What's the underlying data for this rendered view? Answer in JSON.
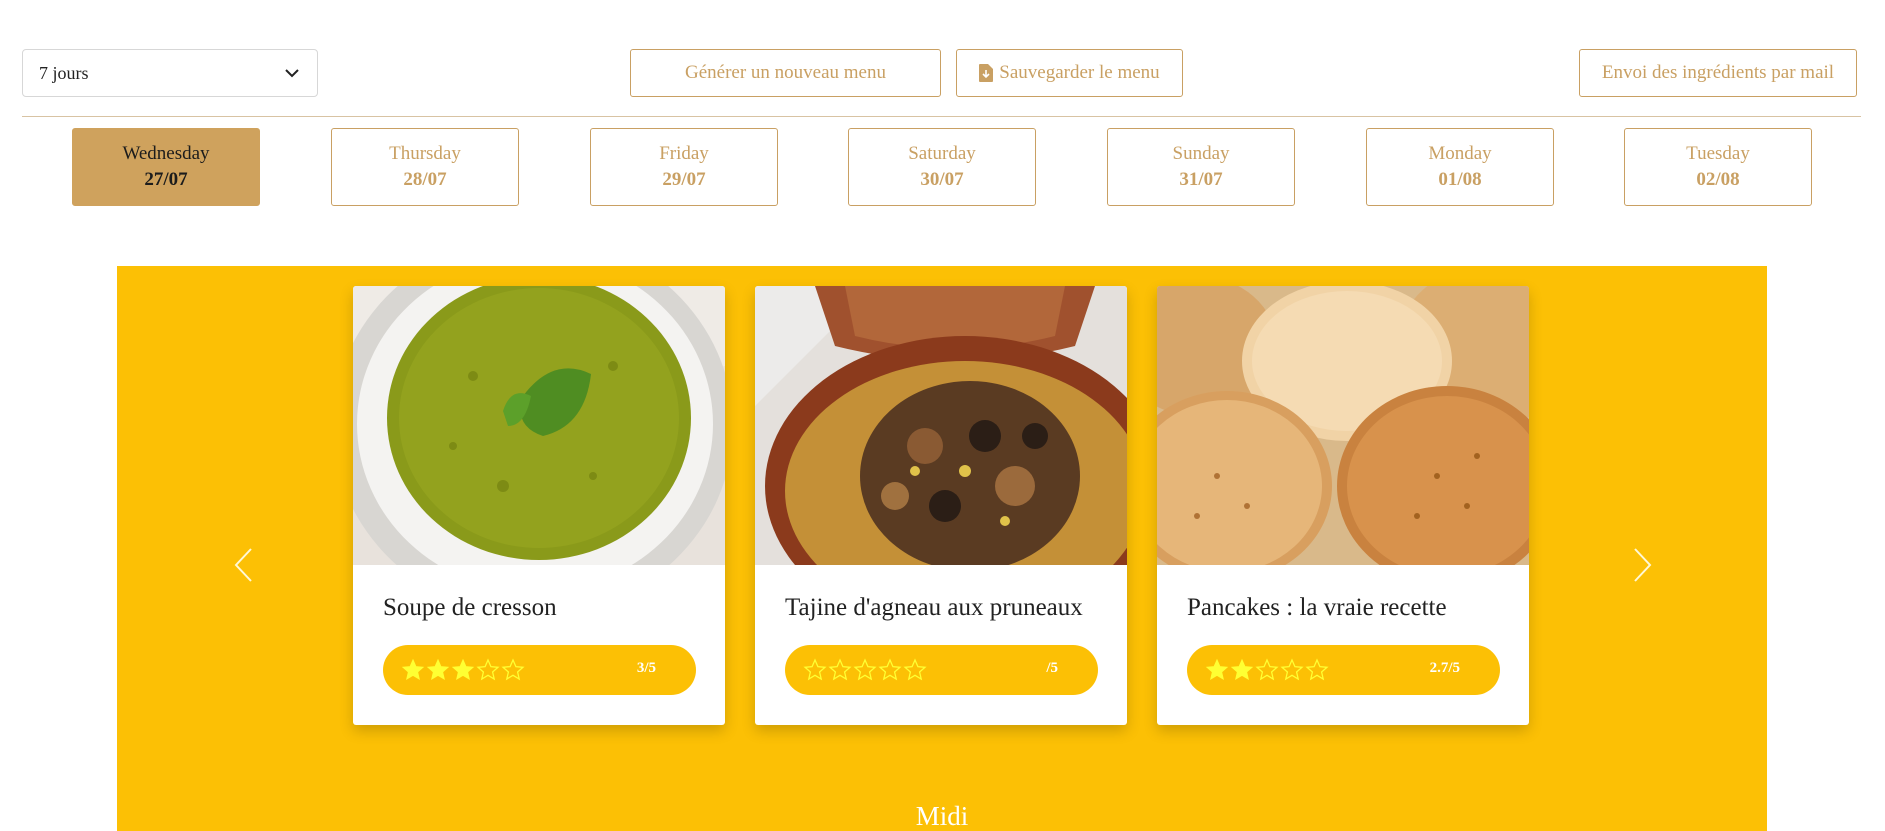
{
  "controls": {
    "duration_value": "7 jours",
    "generate_label": "Générer un nouveau menu",
    "save_label": "Sauvegarder le menu",
    "mail_label": "Envoi des ingrédients par mail"
  },
  "days": [
    {
      "name": "Wednesday",
      "date": "27/07",
      "active": true
    },
    {
      "name": "Thursday",
      "date": "28/07",
      "active": false
    },
    {
      "name": "Friday",
      "date": "29/07",
      "active": false
    },
    {
      "name": "Saturday",
      "date": "30/07",
      "active": false
    },
    {
      "name": "Sunday",
      "date": "31/07",
      "active": false
    },
    {
      "name": "Monday",
      "date": "01/08",
      "active": false
    },
    {
      "name": "Tuesday",
      "date": "02/08",
      "active": false
    }
  ],
  "recipes": [
    {
      "title": "Soupe de cresson",
      "rating_label": "3/5",
      "rating": 3
    },
    {
      "title": "Tajine d'agneau aux pruneaux",
      "rating_label": "/5",
      "rating": 0
    },
    {
      "title": "Pancakes : la vraie recette",
      "rating_label": "2.7/5",
      "rating": 2
    }
  ],
  "meal_label": "Midi",
  "colors": {
    "accent": "#c9a063",
    "active_day": "#cfa25d",
    "carousel_bg": "#fcc005",
    "star": "#ffff33"
  },
  "icons": {
    "dropdown": "chevron-down-icon",
    "save": "file-download-icon",
    "prev": "chevron-left-icon",
    "next": "chevron-right-icon",
    "rating": "star-icon"
  }
}
